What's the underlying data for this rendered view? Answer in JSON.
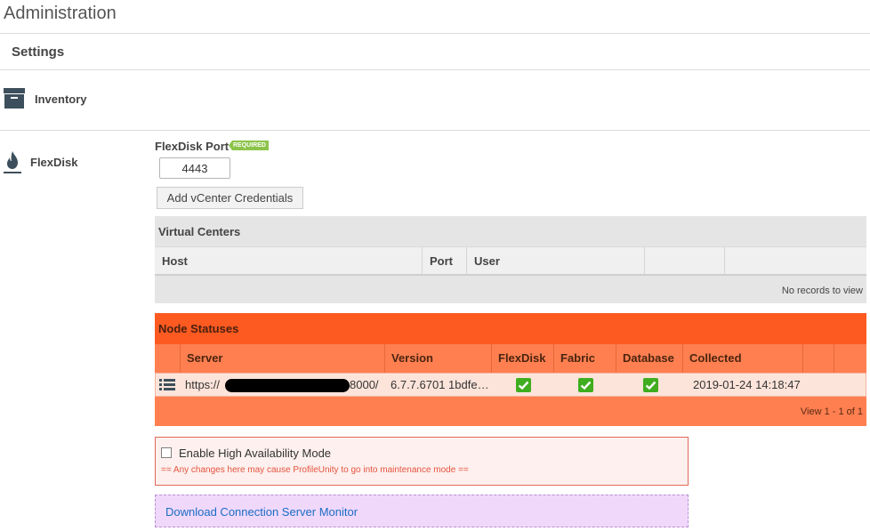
{
  "page": {
    "title": "Administration",
    "section": "Settings"
  },
  "nav": {
    "inventory": {
      "label": "Inventory",
      "icon": "archive-box-icon"
    },
    "flexdisk": {
      "label": "FlexDisk",
      "icon": "flame-icon"
    }
  },
  "flexdisk": {
    "port_label": "FlexDisk Port",
    "required_badge": "REQUIRED",
    "port_value": "4443",
    "add_credentials_label": "Add vCenter Credentials"
  },
  "virtual_centers": {
    "title": "Virtual Centers",
    "columns": [
      "Host",
      "Port",
      "User",
      "",
      ""
    ],
    "footer": "No records to view"
  },
  "node_statuses": {
    "title": "Node Statuses",
    "columns": [
      "",
      "Server",
      "Version",
      "FlexDisk",
      "Fabric",
      "Database",
      "Collected",
      "",
      ""
    ],
    "rows": [
      {
        "server_prefix": "https://",
        "server_suffix": "8000/",
        "version": "6.7.7.6701 1bdfe…",
        "flexdisk": true,
        "fabric": true,
        "database": true,
        "collected": "2019-01-24 14:18:47"
      }
    ],
    "footer": "View 1 - 1 of 1"
  },
  "ha": {
    "label": "Enable High Availability Mode",
    "checked": false,
    "warning": "== Any changes here may cause ProfileUnity to go into maintenance mode =="
  },
  "download": {
    "label": "Download Connection Server Monitor"
  },
  "colors": {
    "node_title_bg": "#fc5a21",
    "node_body_bg": "#ff7f50",
    "check_green": "#3fad1f",
    "required_green": "#8cc34a",
    "link_blue": "#1a6dc4"
  }
}
